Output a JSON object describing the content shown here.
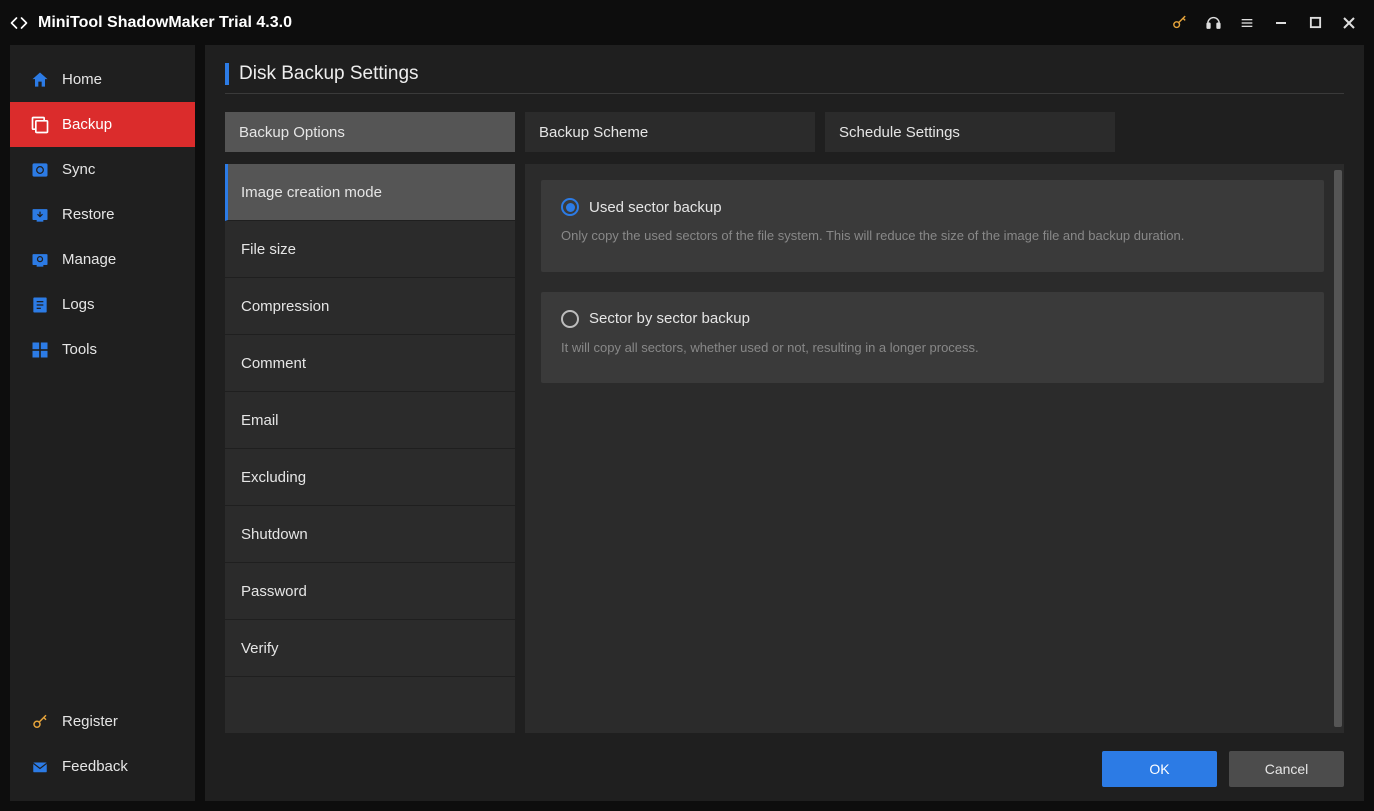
{
  "app": {
    "title": "MiniTool ShadowMaker Trial 4.3.0"
  },
  "sidebar": {
    "items": [
      {
        "label": "Home"
      },
      {
        "label": "Backup"
      },
      {
        "label": "Sync"
      },
      {
        "label": "Restore"
      },
      {
        "label": "Manage"
      },
      {
        "label": "Logs"
      },
      {
        "label": "Tools"
      }
    ],
    "bottom": {
      "register": "Register",
      "feedback": "Feedback"
    }
  },
  "page": {
    "title": "Disk Backup Settings"
  },
  "tabs": [
    {
      "label": "Backup Options"
    },
    {
      "label": "Backup Scheme"
    },
    {
      "label": "Schedule Settings"
    }
  ],
  "sublist": [
    {
      "label": "Image creation mode"
    },
    {
      "label": "File size"
    },
    {
      "label": "Compression"
    },
    {
      "label": "Comment"
    },
    {
      "label": "Email"
    },
    {
      "label": "Excluding"
    },
    {
      "label": "Shutdown"
    },
    {
      "label": "Password"
    },
    {
      "label": "Verify"
    }
  ],
  "options": [
    {
      "title": "Used sector backup",
      "desc": "Only copy the used sectors of the file system. This will reduce the size of the image file and backup duration.",
      "selected": true
    },
    {
      "title": "Sector by sector backup",
      "desc": "It will copy all sectors, whether used or not, resulting in a longer process.",
      "selected": false
    }
  ],
  "footer": {
    "ok": "OK",
    "cancel": "Cancel"
  }
}
